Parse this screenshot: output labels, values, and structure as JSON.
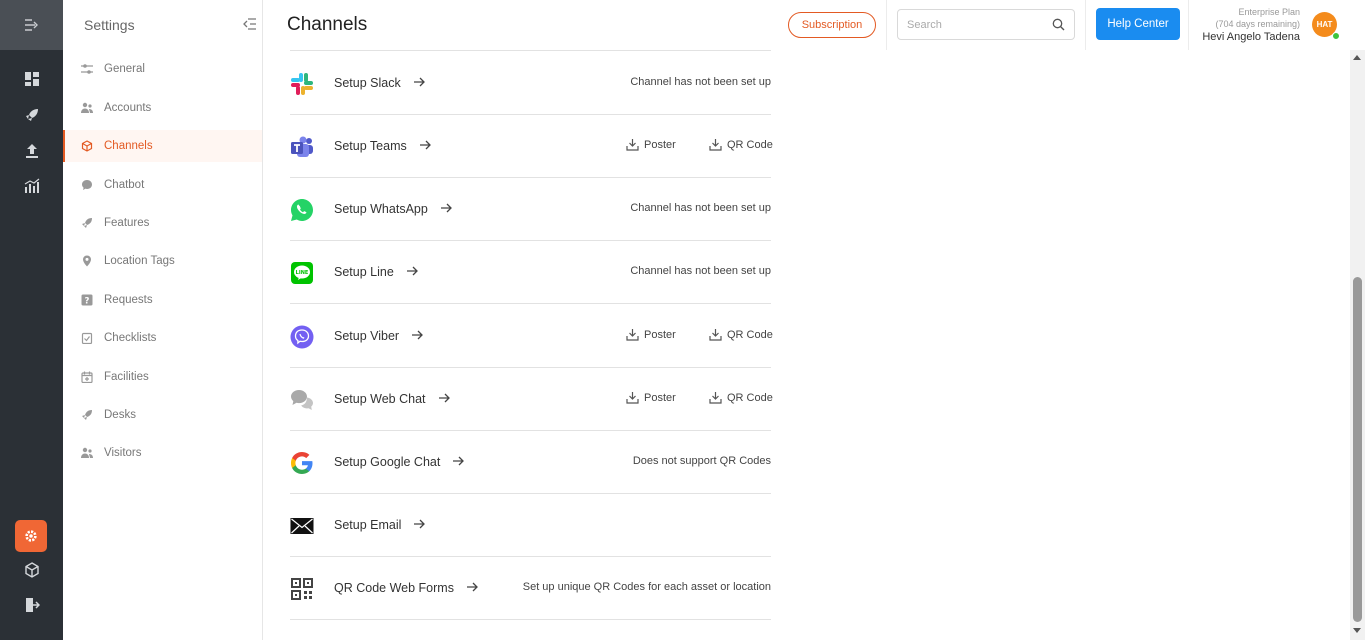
{
  "sidebar": {
    "title": "Settings",
    "items": [
      {
        "label": "General",
        "icon": "sliders-icon"
      },
      {
        "label": "Accounts",
        "icon": "users-icon"
      },
      {
        "label": "Channels",
        "icon": "cube-icon",
        "active": true
      },
      {
        "label": "Chatbot",
        "icon": "chat-bubble-icon"
      },
      {
        "label": "Features",
        "icon": "rocket-icon"
      },
      {
        "label": "Location Tags",
        "icon": "map-pin-icon"
      },
      {
        "label": "Requests",
        "icon": "question-box-icon"
      },
      {
        "label": "Checklists",
        "icon": "clipboard-check-icon"
      },
      {
        "label": "Facilities",
        "icon": "calendar-plus-icon"
      },
      {
        "label": "Desks",
        "icon": "desk-icon"
      },
      {
        "label": "Visitors",
        "icon": "visitors-icon"
      }
    ]
  },
  "rail": {
    "icons": [
      "expand-menu-icon",
      "dashboard-icon",
      "rocket-icon",
      "upload-icon",
      "analytics-icon",
      "settings-icon",
      "cube-icon",
      "logout-icon"
    ],
    "accent": "#f06735"
  },
  "header": {
    "title": "Channels",
    "subscription_label": "Subscription",
    "search_placeholder": "Search",
    "help_label": "Help Center",
    "plan_line1": "Enterprise Plan",
    "plan_line2": "(704 days remaining)",
    "user_name": "Hevi Angelo Tadena",
    "avatar_initials": "HAT"
  },
  "channels": [
    {
      "name": "Setup Slack",
      "status": "Channel has not been set up",
      "logo": "slack-icon"
    },
    {
      "name": "Setup Teams",
      "poster": "Poster",
      "qr": "QR Code",
      "logo": "teams-icon"
    },
    {
      "name": "Setup WhatsApp",
      "status": "Channel has not been set up",
      "logo": "whatsapp-icon"
    },
    {
      "name": "Setup Line",
      "status": "Channel has not been set up",
      "logo": "line-icon"
    },
    {
      "name": "Setup Viber",
      "poster": "Poster",
      "qr": "QR Code",
      "logo": "viber-icon"
    },
    {
      "name": "Setup Web Chat",
      "poster": "Poster",
      "qr": "QR Code",
      "logo": "web-chat-icon"
    },
    {
      "name": "Setup Google Chat",
      "status": "Does not support QR Codes",
      "logo": "google-icon"
    },
    {
      "name": "Setup Email",
      "logo": "email-icon"
    },
    {
      "name": "QR Code Web Forms",
      "status": "Set up unique QR Codes for each asset or location",
      "logo": "qr-code-icon"
    }
  ],
  "colors": {
    "accent": "#e35a23",
    "primary": "#1a8cf0",
    "rail": "#2b3036"
  }
}
